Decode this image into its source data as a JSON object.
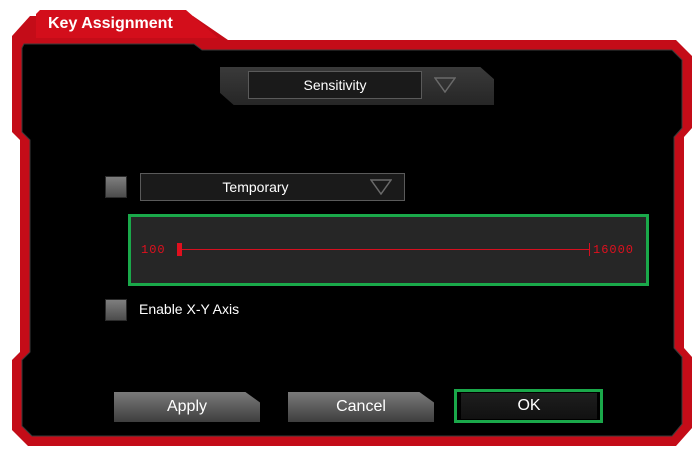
{
  "dialog": {
    "title": "Key Assignment"
  },
  "mode_dropdown": {
    "selected": "Sensitivity"
  },
  "temporary": {
    "checkbox_checked": false,
    "dropdown_selected": "Temporary"
  },
  "sensitivity_slider": {
    "min_label": "100",
    "max_label": "16000",
    "min": 100,
    "max": 16000,
    "value": 100
  },
  "xy_axis": {
    "checkbox_checked": false,
    "label": "Enable X-Y Axis"
  },
  "buttons": {
    "apply": "Apply",
    "cancel": "Cancel",
    "ok": "OK"
  },
  "colors": {
    "accent_red": "#e0101e",
    "highlight_green": "#1aa84a",
    "panel_black": "#000000"
  }
}
